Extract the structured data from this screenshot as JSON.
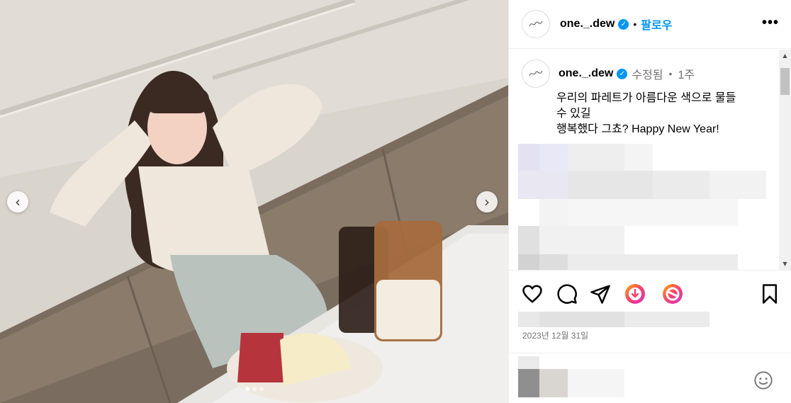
{
  "photo": {
    "description_icon": "post-photo",
    "carousel_prev_icon": "chevron-left-icon",
    "carousel_next_icon": "chevron-right-icon",
    "prev_glyph": "‹",
    "next_glyph": "›",
    "slide_count": 3,
    "active_slide": 1
  },
  "header": {
    "username": "one._.dew",
    "verified_glyph": "✓",
    "separator": "•",
    "follow_label": "팔로우",
    "more_glyph": "•••"
  },
  "caption": {
    "username": "one._.dew",
    "verified_glyph": "✓",
    "edited_label": "수정됨",
    "separator": "•",
    "age": "1주",
    "lines": [
      "우리의 파레트가 아름다운 색으로 물들",
      "수 있길",
      "행복했다 그쵸? Happy New Year!"
    ]
  },
  "scrollbar": {
    "up_glyph": "▲",
    "down_glyph": "▼"
  },
  "actions": {
    "icons": [
      "heart-icon",
      "comment-icon",
      "share-icon",
      "gift-icon",
      "remix-icon",
      "bookmark-icon"
    ]
  },
  "post_date": "2023년 12월 31일",
  "comment_bar": {
    "emoji_icon": "emoji-icon"
  },
  "colors": {
    "accent": "#0095f6",
    "muted_text": "#737373",
    "border": "#efefef"
  }
}
